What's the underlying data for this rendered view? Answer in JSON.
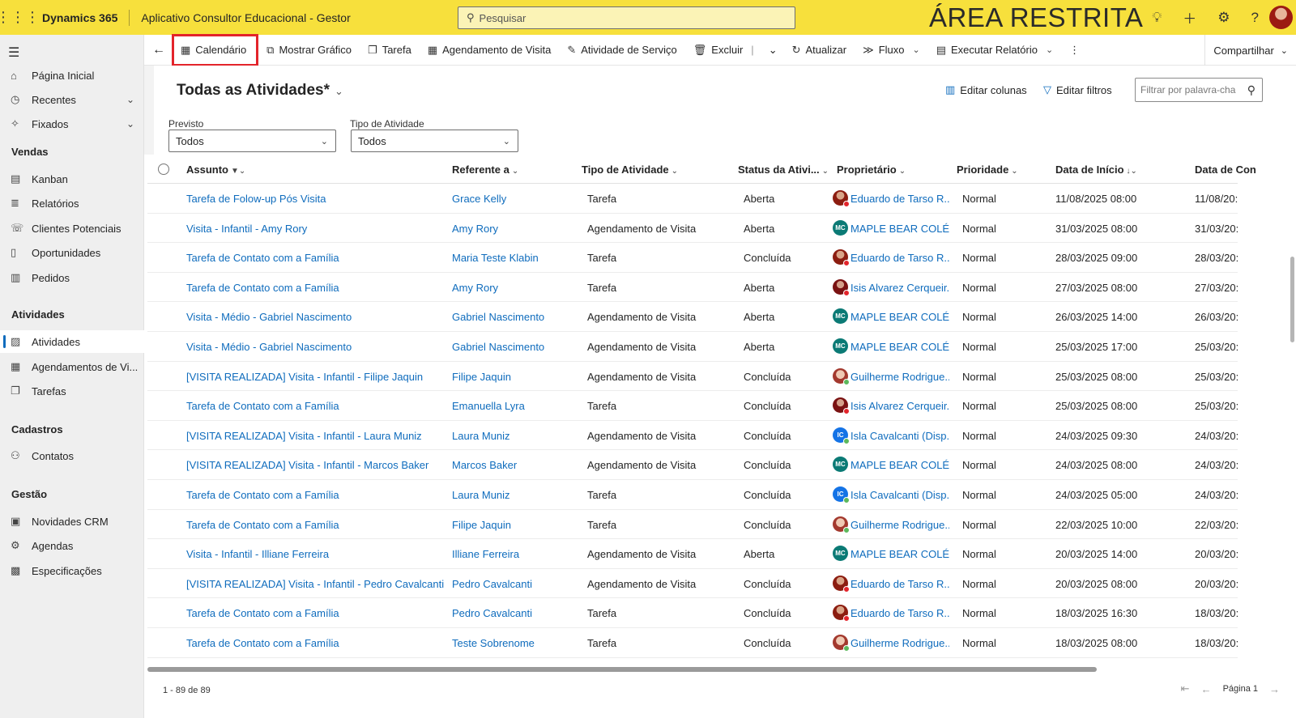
{
  "topbar": {
    "brand": "Dynamics 365",
    "app_name": "Aplicativo Consultor Educacional - Gestor",
    "search_placeholder": "Pesquisar",
    "restricted_label": "ÁREA RESTRITA",
    "background_color": "#f7e03c"
  },
  "sidebar": {
    "items": [
      {
        "label": "Página Inicial",
        "icon": "home-icon"
      },
      {
        "label": "Recentes",
        "icon": "clock-icon"
      },
      {
        "label": "Fixados",
        "icon": "pin-icon"
      }
    ],
    "sections": [
      {
        "title": "Vendas",
        "items": [
          "Kanban",
          "Relatórios",
          "Clientes Potenciais",
          "Oportunidades",
          "Pedidos"
        ]
      },
      {
        "title": "Atividades",
        "items": [
          "Atividades",
          "Agendamentos de Vi...",
          "Tarefas"
        ]
      },
      {
        "title": "Cadastros",
        "items": [
          "Contatos"
        ]
      },
      {
        "title": "Gestão",
        "items": [
          "Novidades CRM",
          "Agendas",
          "Especificações"
        ]
      }
    ]
  },
  "commandbar": {
    "calendar": "Calendário",
    "show_chart": "Mostrar Gráfico",
    "task": "Tarefa",
    "visit_schedule": "Agendamento de Visita",
    "service_activity": "Atividade de Serviço",
    "delete": "Excluir",
    "refresh": "Atualizar",
    "flow": "Fluxo",
    "run_report": "Executar Relatório",
    "share": "Compartilhar",
    "highlight_color": "#e3242b"
  },
  "view": {
    "title": "Todas as Atividades*",
    "edit_columns": "Editar colunas",
    "edit_filters": "Editar filtros",
    "filter_placeholder": "Filtrar por palavra-cha",
    "filters": [
      {
        "label": "Previsto",
        "value": "Todos"
      },
      {
        "label": "Tipo de Atividade",
        "value": "Todos"
      }
    ]
  },
  "grid": {
    "columns": [
      "Assunto",
      "Referente a",
      "Tipo de Atividade",
      "Status da Ativi...",
      "Proprietário",
      "Prioridade",
      "Data de Início",
      "Data de Con"
    ],
    "rows": [
      {
        "subject": "Tarefa de Folow-up Pós Visita",
        "regarding": "Grace Kelly",
        "type": "Tarefa",
        "status": "Aberta",
        "owner": "Eduardo de Tarso R...",
        "owner_av": "photo-red",
        "priority": "Normal",
        "start": "11/08/2025 08:00",
        "due": "11/08/20:"
      },
      {
        "subject": "Visita - Infantil - Amy Rory",
        "regarding": "Amy Rory",
        "type": "Agendamento de Visita",
        "status": "Aberta",
        "owner": "MAPLE BEAR COLÉG...",
        "owner_av": "MC",
        "priority": "Normal",
        "start": "31/03/2025 08:00",
        "due": "31/03/20:"
      },
      {
        "subject": "Tarefa de Contato com a Família",
        "regarding": "Maria Teste Klabin",
        "type": "Tarefa",
        "status": "Concluída",
        "owner": "Eduardo de Tarso R...",
        "owner_av": "photo-red",
        "priority": "Normal",
        "start": "28/03/2025 09:00",
        "due": "28/03/20:"
      },
      {
        "subject": "Tarefa de Contato com a Família",
        "regarding": "Amy Rory",
        "type": "Tarefa",
        "status": "Aberta",
        "owner": "Isis Alvarez Cerqueir...",
        "owner_av": "photo-dark",
        "priority": "Normal",
        "start": "27/03/2025 08:00",
        "due": "27/03/20:"
      },
      {
        "subject": "Visita - Médio - Gabriel Nascimento",
        "regarding": "Gabriel Nascimento",
        "type": "Agendamento de Visita",
        "status": "Aberta",
        "owner": "MAPLE BEAR COLÉG...",
        "owner_av": "MC",
        "priority": "Normal",
        "start": "26/03/2025 14:00",
        "due": "26/03/20:"
      },
      {
        "subject": "Visita - Médio - Gabriel Nascimento",
        "regarding": "Gabriel Nascimento",
        "type": "Agendamento de Visita",
        "status": "Aberta",
        "owner": "MAPLE BEAR COLÉG...",
        "owner_av": "MC",
        "priority": "Normal",
        "start": "25/03/2025 17:00",
        "due": "25/03/20:"
      },
      {
        "subject": "[VISITA REALIZADA] Visita - Infantil - Filipe Jaquin",
        "regarding": "Filipe Jaquin",
        "type": "Agendamento de Visita",
        "status": "Concluída",
        "owner": "Guilherme Rodrigue...",
        "owner_av": "photo-light",
        "priority": "Normal",
        "start": "25/03/2025 08:00",
        "due": "25/03/20:"
      },
      {
        "subject": "Tarefa de Contato com a Família",
        "regarding": "Emanuella Lyra",
        "type": "Tarefa",
        "status": "Concluída",
        "owner": "Isis Alvarez Cerqueir...",
        "owner_av": "photo-dark",
        "priority": "Normal",
        "start": "25/03/2025 08:00",
        "due": "25/03/20:"
      },
      {
        "subject": "[VISITA REALIZADA] Visita - Infantil - Laura Muniz",
        "regarding": "Laura Muniz",
        "type": "Agendamento de Visita",
        "status": "Concluída",
        "owner": "Isla Cavalcanti (Disp...",
        "owner_av": "IC",
        "priority": "Normal",
        "start": "24/03/2025 09:30",
        "due": "24/03/20:"
      },
      {
        "subject": "[VISITA REALIZADA] Visita - Infantil - Marcos Baker",
        "regarding": "Marcos Baker",
        "type": "Agendamento de Visita",
        "status": "Concluída",
        "owner": "MAPLE BEAR COLÉG...",
        "owner_av": "MC",
        "priority": "Normal",
        "start": "24/03/2025 08:00",
        "due": "24/03/20:"
      },
      {
        "subject": "Tarefa de Contato com a Família",
        "regarding": "Laura Muniz",
        "type": "Tarefa",
        "status": "Concluída",
        "owner": "Isla Cavalcanti (Disp...",
        "owner_av": "IC",
        "priority": "Normal",
        "start": "24/03/2025 05:00",
        "due": "24/03/20:"
      },
      {
        "subject": "Tarefa de Contato com a Família",
        "regarding": "Filipe Jaquin",
        "type": "Tarefa",
        "status": "Concluída",
        "owner": "Guilherme Rodrigue...",
        "owner_av": "photo-light",
        "priority": "Normal",
        "start": "22/03/2025 10:00",
        "due": "22/03/20:"
      },
      {
        "subject": "Visita - Infantil - Illiane Ferreira",
        "regarding": "Illiane Ferreira",
        "type": "Agendamento de Visita",
        "status": "Aberta",
        "owner": "MAPLE BEAR COLÉG...",
        "owner_av": "MC",
        "priority": "Normal",
        "start": "20/03/2025 14:00",
        "due": "20/03/20:"
      },
      {
        "subject": "[VISITA REALIZADA] Visita - Infantil - Pedro Cavalcanti",
        "regarding": "Pedro Cavalcanti",
        "type": "Agendamento de Visita",
        "status": "Concluída",
        "owner": "Eduardo de Tarso R...",
        "owner_av": "photo-red",
        "priority": "Normal",
        "start": "20/03/2025 08:00",
        "due": "20/03/20:"
      },
      {
        "subject": "Tarefa de Contato com a Família",
        "regarding": "Pedro Cavalcanti",
        "type": "Tarefa",
        "status": "Concluída",
        "owner": "Eduardo de Tarso R...",
        "owner_av": "photo-red",
        "priority": "Normal",
        "start": "18/03/2025 16:30",
        "due": "18/03/20:"
      },
      {
        "subject": "Tarefa de Contato com a Família",
        "regarding": "Teste Sobrenome",
        "type": "Tarefa",
        "status": "Concluída",
        "owner": "Guilherme Rodrigue...",
        "owner_av": "photo-light",
        "priority": "Normal",
        "start": "18/03/2025 08:00",
        "due": "18/03/20:"
      }
    ]
  },
  "footer": {
    "count": "1 - 89 de 89",
    "page": "Página 1"
  }
}
